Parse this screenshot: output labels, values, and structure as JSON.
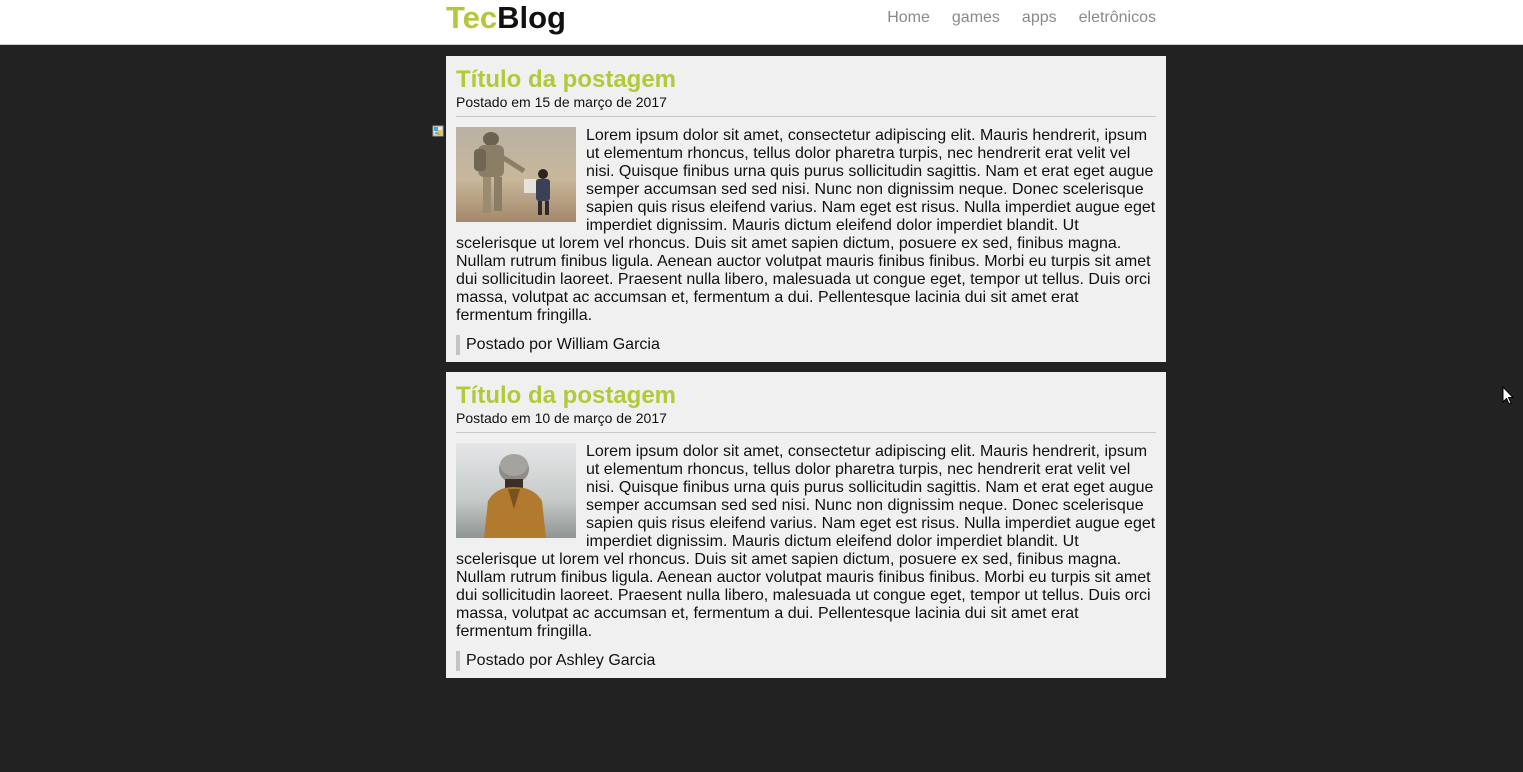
{
  "header": {
    "logo_part1": "Tec",
    "logo_part2": "Blog",
    "nav": [
      "Home",
      "games",
      "apps",
      "eletrônicos"
    ]
  },
  "posts": [
    {
      "title": "Título da postagem",
      "date": "Postado em 15 de março de 2017",
      "body": "Lorem ipsum dolor sit amet, consectetur adipiscing elit. Mauris hendrerit, ipsum ut elementum rhoncus, tellus dolor pharetra turpis, nec hendrerit erat velit vel nisi. Quisque finibus urna quis purus sollicitudin sagittis. Nam et erat eget augue semper accumsan sed sed nisi. Nunc non dignissim neque. Donec scelerisque sapien quis risus eleifend varius. Nam eget est risus. Nulla imperdiet augue eget imperdiet dignissim. Mauris dictum eleifend dolor imperdiet blandit. Ut scelerisque ut lorem vel rhoncus. Duis sit amet sapien dictum, posuere ex sed, finibus magna. Nullam rutrum finibus ligula. Aenean auctor volutpat mauris finibus finibus. Morbi eu turpis sit amet dui sollicitudin laoreet. Praesent nulla libero, malesuada ut congue eget, tempor ut tellus. Duis orci massa, volutpat ac accumsan et, fermentum a dui. Pellentesque lacinia dui sit amet erat fermentum fringilla.",
      "author": "Postado por William Garcia"
    },
    {
      "title": "Título da postagem",
      "date": "Postado em 10 de março de 2017",
      "body": "Lorem ipsum dolor sit amet, consectetur adipiscing elit. Mauris hendrerit, ipsum ut elementum rhoncus, tellus dolor pharetra turpis, nec hendrerit erat velit vel nisi. Quisque finibus urna quis purus sollicitudin sagittis. Nam et erat eget augue semper accumsan sed sed nisi. Nunc non dignissim neque. Donec scelerisque sapien quis risus eleifend varius. Nam eget est risus. Nulla imperdiet augue eget imperdiet dignissim. Mauris dictum eleifend dolor imperdiet blandit. Ut scelerisque ut lorem vel rhoncus. Duis sit amet sapien dictum, posuere ex sed, finibus magna. Nullam rutrum finibus ligula. Aenean auctor volutpat mauris finibus finibus. Morbi eu turpis sit amet dui sollicitudin laoreet. Praesent nulla libero, malesuada ut congue eget, tempor ut tellus. Duis orci massa, volutpat ac accumsan et, fermentum a dui. Pellentesque lacinia dui sit amet erat fermentum fringilla.",
      "author": "Postado por Ashley Garcia"
    }
  ],
  "colors": {
    "accent": "#b3c83a",
    "page_bg": "#222222",
    "card_bg": "#f0f0f0",
    "nav_text": "#8a8a8a"
  },
  "icons": {
    "broken_image": "broken-image-icon",
    "cursor": "mouse-cursor-icon"
  }
}
